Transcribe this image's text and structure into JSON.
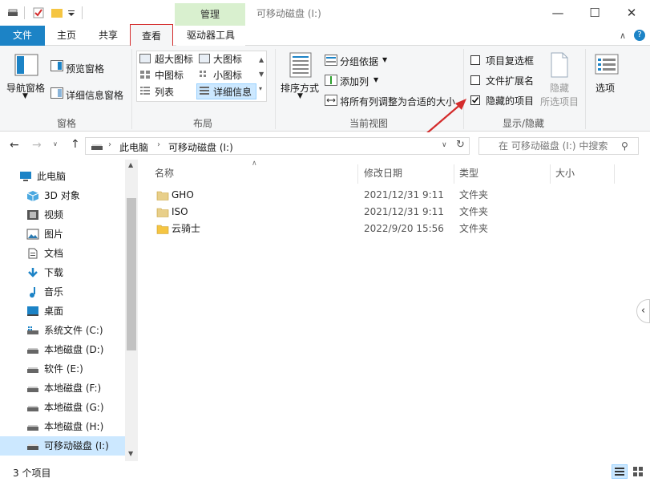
{
  "window": {
    "title": "可移动磁盘 (I:)",
    "contextual_tab": "管理"
  },
  "tabs": {
    "file": "文件",
    "home": "主页",
    "share": "共享",
    "view": "查看",
    "drive_tools": "驱动器工具"
  },
  "ribbon": {
    "panes": {
      "group": "窗格",
      "nav_pane": "导航窗格",
      "preview_pane": "预览窗格",
      "details_pane": "详细信息窗格"
    },
    "layout": {
      "group": "布局",
      "extra_large": "超大图标",
      "large": "大图标",
      "medium": "中图标",
      "small": "小图标",
      "list": "列表",
      "details": "详细信息"
    },
    "current_view": {
      "group": "当前视图",
      "sort_by": "排序方式",
      "group_by": "分组依据",
      "add_column": "添加列",
      "fit_columns": "将所有列调整为合适的大小"
    },
    "show_hide": {
      "group": "显示/隐藏",
      "item_checkboxes": "项目复选框",
      "file_extensions": "文件扩展名",
      "hidden_items": "隐藏的项目",
      "hidden_items_checked": true,
      "hide_selected": "隐藏",
      "hide_selected_2": "所选项目",
      "options": "选项"
    }
  },
  "navbar": {
    "crumb1": "此电脑",
    "crumb2": "可移动磁盘 (I:)",
    "search_placeholder": "在 可移动磁盘 (I:) 中搜索"
  },
  "sidebar": {
    "items": [
      {
        "label": "此电脑",
        "icon": "pc-icon"
      },
      {
        "label": "3D 对象",
        "icon": "cube-icon"
      },
      {
        "label": "视频",
        "icon": "video-icon"
      },
      {
        "label": "图片",
        "icon": "picture-icon"
      },
      {
        "label": "文档",
        "icon": "document-icon"
      },
      {
        "label": "下载",
        "icon": "download-icon"
      },
      {
        "label": "音乐",
        "icon": "music-icon"
      },
      {
        "label": "桌面",
        "icon": "desktop-icon"
      },
      {
        "label": "系统文件 (C:)",
        "icon": "system-drive-icon"
      },
      {
        "label": "本地磁盘 (D:)",
        "icon": "drive-icon"
      },
      {
        "label": "软件 (E:)",
        "icon": "drive-icon"
      },
      {
        "label": "本地磁盘 (F:)",
        "icon": "drive-icon"
      },
      {
        "label": "本地磁盘 (G:)",
        "icon": "drive-icon"
      },
      {
        "label": "本地磁盘 (H:)",
        "icon": "drive-icon"
      },
      {
        "label": "可移动磁盘 (I:)",
        "icon": "usb-drive-icon"
      }
    ]
  },
  "columns": {
    "name": "名称",
    "date": "修改日期",
    "type": "类型",
    "size": "大小"
  },
  "files": [
    {
      "name": "GHO",
      "date": "2021/12/31 9:11",
      "type": "文件夹",
      "hidden": true
    },
    {
      "name": "ISO",
      "date": "2021/12/31 9:11",
      "type": "文件夹",
      "hidden": true
    },
    {
      "name": "云骑士",
      "date": "2022/9/20 15:56",
      "type": "文件夹",
      "hidden": false
    }
  ],
  "status": {
    "count": "3 个项目"
  },
  "colors": {
    "accent": "#1c83c6",
    "selection": "#cce8ff",
    "highlight_red": "#d42c2c",
    "manage": "#d9f0cf",
    "folder": "#f5c542"
  }
}
